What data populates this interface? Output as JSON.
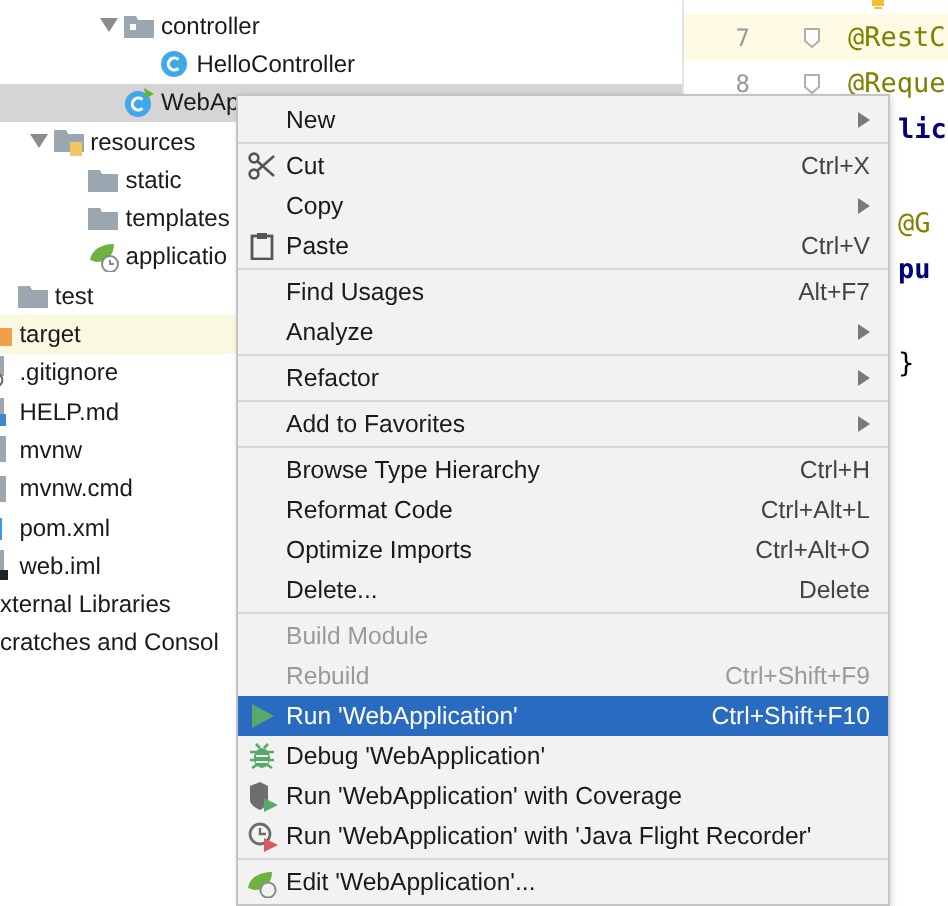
{
  "project_tree": {
    "items": [
      {
        "children": [
          {
            "children": [
              {
                "children": [
                  {
                    "children": [
                      {
                        "children": [
                          {
                            "label": "controller",
                            "kind": "package",
                            "expanded": true,
                            "selected": false,
                            "tinted": false,
                            "children": [
                              {
                                "label": "HelloController",
                                "kind": "class",
                                "selected": false,
                                "tinted": false
                              }
                            ]
                          },
                          {
                            "label": "WebAp",
                            "kind": "spring-class",
                            "selected": true,
                            "tinted": false
                          }
                        ]
                      }
                    ]
                  },
                  {
                    "label": "resources",
                    "kind": "resources-folder",
                    "expanded": true,
                    "selected": false,
                    "tinted": false,
                    "children": [
                      {
                        "label": "static",
                        "kind": "folder",
                        "selected": false,
                        "tinted": false
                      },
                      {
                        "label": "templates",
                        "kind": "folder",
                        "selected": false,
                        "tinted": false
                      },
                      {
                        "label": "applicatio",
                        "kind": "config",
                        "selected": false,
                        "tinted": false
                      }
                    ]
                  }
                ]
              },
              {
                "label": "test",
                "kind": "folder",
                "selected": false,
                "tinted": false
              }
            ]
          },
          {
            "label": "target",
            "kind": "excluded-folder",
            "selected": false,
            "tinted": true
          },
          {
            "label": ".gitignore",
            "kind": "ignore-file",
            "selected": false,
            "tinted": false
          },
          {
            "label": "HELP.md",
            "kind": "markdown-file",
            "selected": false,
            "tinted": false
          },
          {
            "label": "mvnw",
            "kind": "file",
            "selected": false,
            "tinted": false
          },
          {
            "label": "mvnw.cmd",
            "kind": "file",
            "selected": false,
            "tinted": false
          },
          {
            "label": "pom.xml",
            "kind": "maven-file",
            "selected": false,
            "tinted": false
          },
          {
            "label": "web.iml",
            "kind": "module-file",
            "selected": false,
            "tinted": false
          }
        ]
      },
      {
        "label": "xternal Libraries",
        "kind": "plain",
        "selected": false,
        "tinted": false
      },
      {
        "label": "cratches and Consol",
        "kind": "plain",
        "selected": false,
        "tinted": false
      }
    ]
  },
  "editor": {
    "lines": [
      {
        "kind": "annotation",
        "number": "7",
        "text": "@RestC",
        "current": true,
        "fold": true
      },
      {
        "kind": "annotation",
        "number": "8",
        "text": "@Reque",
        "current": false,
        "fold": true
      },
      {
        "kind": "keyword",
        "text": "lic",
        "current": false
      },
      {
        "kind": "blank"
      },
      {
        "kind": "annotation",
        "text": "@G",
        "current": false
      },
      {
        "kind": "keyword",
        "text": "pu",
        "current": false
      },
      {
        "kind": "blank"
      },
      {
        "kind": "plain",
        "text": "}",
        "current": false
      }
    ]
  },
  "context_menu": {
    "groups": [
      [
        {
          "label": "New",
          "kind": "plain",
          "submenu": true,
          "disabled": false,
          "selected": false
        }
      ],
      [
        {
          "label": "Cut",
          "kind": "scissors",
          "shortcut": "Ctrl+X",
          "submenu": false,
          "disabled": false,
          "selected": false
        },
        {
          "label": "Copy",
          "kind": "plain",
          "submenu": true,
          "disabled": false,
          "selected": false
        },
        {
          "label": "Paste",
          "kind": "clipboard",
          "shortcut": "Ctrl+V",
          "submenu": false,
          "disabled": false,
          "selected": false
        }
      ],
      [
        {
          "label": "Find Usages",
          "kind": "plain",
          "shortcut": "Alt+F7",
          "submenu": false,
          "disabled": false,
          "selected": false
        },
        {
          "label": "Analyze",
          "kind": "plain",
          "submenu": true,
          "disabled": false,
          "selected": false
        }
      ],
      [
        {
          "label": "Refactor",
          "kind": "plain",
          "submenu": true,
          "disabled": false,
          "selected": false
        }
      ],
      [
        {
          "label": "Add to Favorites",
          "kind": "plain",
          "submenu": true,
          "disabled": false,
          "selected": false
        }
      ],
      [
        {
          "label": "Browse Type Hierarchy",
          "kind": "plain",
          "shortcut": "Ctrl+H",
          "submenu": false,
          "disabled": false,
          "selected": false
        },
        {
          "label": "Reformat Code",
          "kind": "plain",
          "shortcut": "Ctrl+Alt+L",
          "submenu": false,
          "disabled": false,
          "selected": false
        },
        {
          "label": "Optimize Imports",
          "kind": "plain",
          "shortcut": "Ctrl+Alt+O",
          "submenu": false,
          "disabled": false,
          "selected": false
        },
        {
          "label": "Delete...",
          "kind": "plain",
          "shortcut": "Delete",
          "submenu": false,
          "disabled": false,
          "selected": false
        }
      ],
      [
        {
          "label": "Build Module",
          "kind": "plain",
          "submenu": false,
          "disabled": true,
          "selected": false
        },
        {
          "label": "Rebuild",
          "kind": "plain",
          "shortcut": "Ctrl+Shift+F9",
          "submenu": false,
          "disabled": true,
          "selected": false
        },
        {
          "label": "Run 'WebApplication'",
          "kind": "run",
          "shortcut": "Ctrl+Shift+F10",
          "submenu": false,
          "disabled": false,
          "selected": true
        },
        {
          "label": "Debug 'WebApplication'",
          "kind": "debug",
          "submenu": false,
          "disabled": false,
          "selected": false
        },
        {
          "label": "Run 'WebApplication' with Coverage",
          "kind": "coverage",
          "submenu": false,
          "disabled": false,
          "selected": false
        },
        {
          "label": "Run 'WebApplication' with 'Java Flight Recorder'",
          "kind": "profiler",
          "submenu": false,
          "disabled": false,
          "selected": false
        }
      ],
      [
        {
          "label": "Edit 'WebApplication'...",
          "kind": "edit-config",
          "submenu": false,
          "disabled": false,
          "selected": false
        }
      ]
    ]
  }
}
